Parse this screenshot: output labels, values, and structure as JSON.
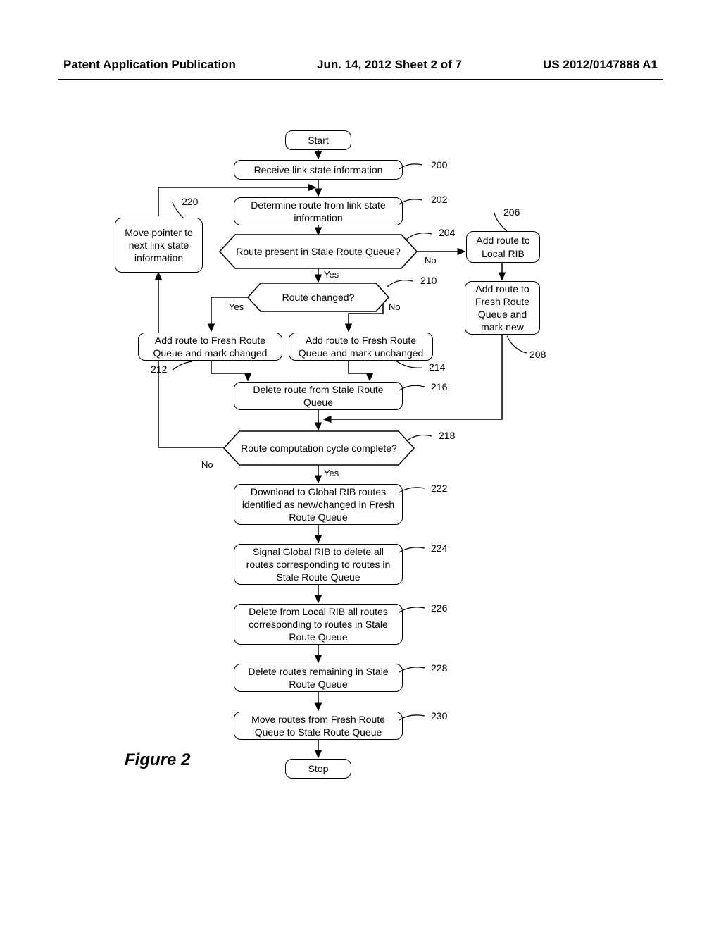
{
  "header": {
    "left": "Patent Application Publication",
    "center": "Jun. 14, 2012   Sheet 2 of 7",
    "right": "US 2012/0147888 A1"
  },
  "figure_label": "Figure 2",
  "nodes": {
    "start": "Start",
    "n200": "Receive link state information",
    "n202": "Determine route from link state information",
    "n204": "Route present in Stale Route Queue?",
    "n206": "Add route to Local RIB",
    "n208": "Add route to Fresh Route Queue and mark new",
    "n210": "Route changed?",
    "n212": "Add route to Fresh Route Queue and mark changed",
    "n214": "Add route to Fresh Route Queue and mark unchanged",
    "n216": "Delete route from Stale Route Queue",
    "n218": "Route computation cycle complete?",
    "n220": "Move pointer to next link state information",
    "n222": "Download to Global RIB routes identified as new/changed in Fresh Route Queue",
    "n224": "Signal Global RIB to delete all routes corresponding to routes in Stale Route Queue",
    "n226": "Delete from Local RIB all routes corresponding to routes in Stale Route Queue",
    "n228": "Delete routes remaining in Stale Route Queue",
    "n230": "Move routes from Fresh Route Queue to Stale Route Queue",
    "stop": "Stop"
  },
  "refs": {
    "r200": "200",
    "r202": "202",
    "r204": "204",
    "r206": "206",
    "r208": "208",
    "r210": "210",
    "r212": "212",
    "r214": "214",
    "r216": "216",
    "r218": "218",
    "r220": "220",
    "r222": "222",
    "r224": "224",
    "r226": "226",
    "r228": "228",
    "r230": "230"
  },
  "labels": {
    "yes": "Yes",
    "no": "No"
  }
}
